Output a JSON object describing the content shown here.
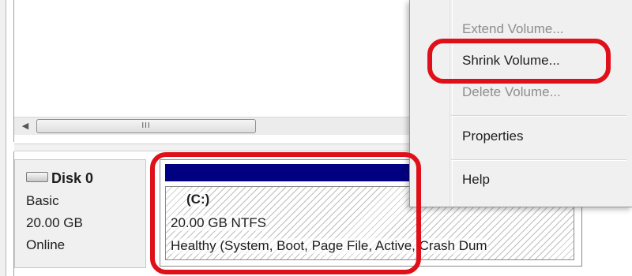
{
  "volume_list": {
    "scrollbar_grip": "III"
  },
  "disk": {
    "name": "Disk 0",
    "type": "Basic",
    "size": "20.00 GB",
    "status": "Online"
  },
  "volume": {
    "name": "(C:)",
    "size_fs": "20.00 GB NTFS",
    "health": "Healthy (System, Boot, Page File, Active, Crash Dum"
  },
  "context_menu": {
    "items": [
      {
        "label": "Extend Volume...",
        "enabled": false
      },
      {
        "label": "Shrink Volume...",
        "enabled": true
      },
      {
        "label": "Delete Volume...",
        "enabled": false
      },
      {
        "label": "Properties",
        "enabled": true
      },
      {
        "label": "Help",
        "enabled": true
      }
    ]
  },
  "colors": {
    "volume_header": "#010080",
    "highlight": "#e0101a"
  },
  "icons": {
    "scroll_left": "scroll-left-arrow-icon",
    "disk": "disk-drive-icon"
  }
}
